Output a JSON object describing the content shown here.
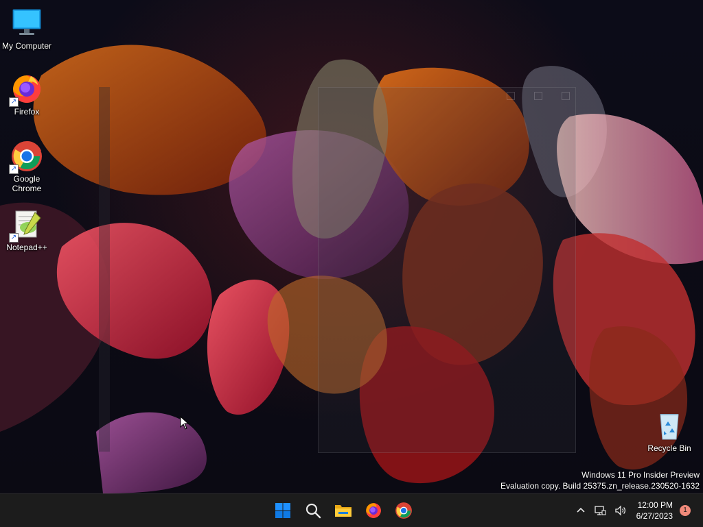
{
  "desktop": {
    "icons": [
      {
        "label": "My Computer",
        "icon": "monitor-icon"
      },
      {
        "label": "Firefox",
        "icon": "firefox-icon",
        "shortcut": true
      },
      {
        "label": "Google Chrome",
        "icon": "chrome-icon",
        "shortcut": true
      },
      {
        "label": "Notepad++",
        "icon": "notepadpp-icon",
        "shortcut": true
      },
      {
        "label": "Recycle Bin",
        "icon": "recycle-bin-icon"
      }
    ],
    "watermark": {
      "line1": "Windows 11 Pro Insider Preview",
      "line2": "Evaluation copy. Build 25375.zn_release.230520-1632"
    }
  },
  "taskbar": {
    "pinned": [
      {
        "name": "start",
        "icon": "windows-start-icon"
      },
      {
        "name": "search",
        "icon": "search-icon"
      },
      {
        "name": "file-explorer",
        "icon": "folder-icon"
      },
      {
        "name": "firefox",
        "icon": "firefox-icon"
      },
      {
        "name": "chrome",
        "icon": "chrome-icon"
      }
    ],
    "tray": {
      "time": "12:00 PM",
      "date": "6/27/2023",
      "notification_count": "1"
    }
  },
  "colors": {
    "taskbar_bg": "#1c1c1c",
    "start_blue": "#0f7ae5",
    "notification_badge": "#f08a7a"
  }
}
